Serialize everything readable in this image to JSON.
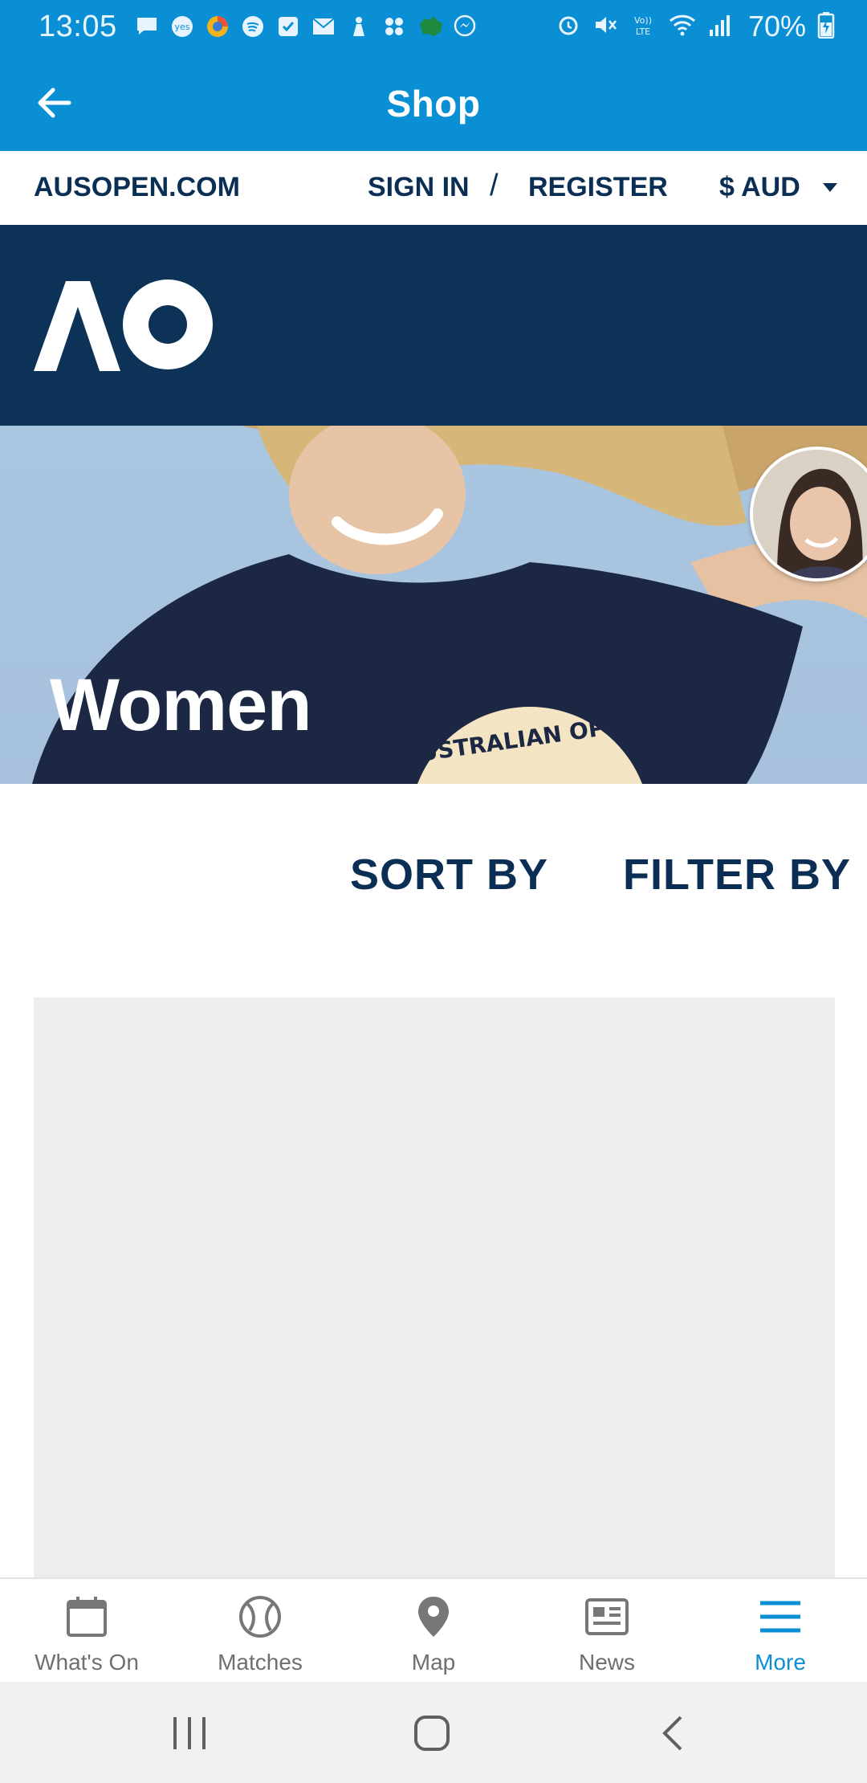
{
  "status_bar": {
    "time": "13:05",
    "battery": "70%",
    "notification_icons": [
      "message-icon",
      "yes-icon",
      "browser-icon",
      "spotify-icon",
      "tasks-icon",
      "mail-icon",
      "bixby-icon",
      "app-icon",
      "australia-icon",
      "messenger-icon"
    ],
    "system_icons": [
      "alarm-icon",
      "mute-icon",
      "volte-icon",
      "wifi-icon",
      "signal-icon",
      "battery-icon"
    ]
  },
  "app_bar": {
    "title": "Shop",
    "back_icon": "arrow-left-icon"
  },
  "utility_bar": {
    "site_link": "AUSOPEN.COM",
    "sign_in": "SIGN IN",
    "separator": "/",
    "register": "REGISTER",
    "currency": "$ AUD"
  },
  "brand": {
    "logo_text": "AO"
  },
  "hero": {
    "title": "Women",
    "shirt_text": "AUSTRALIAN OPEN"
  },
  "controls": {
    "sort": "SORT BY",
    "filter": "FILTER BY"
  },
  "bottom_nav": {
    "items": [
      {
        "label": "What's On",
        "icon": "calendar-icon"
      },
      {
        "label": "Matches",
        "icon": "tennis-ball-icon"
      },
      {
        "label": "Map",
        "icon": "map-pin-icon"
      },
      {
        "label": "News",
        "icon": "news-icon"
      },
      {
        "label": "More",
        "icon": "menu-icon"
      }
    ],
    "active": "More"
  },
  "colors": {
    "primary": "#0a8fd4",
    "navy": "#0c3257",
    "text_navy": "#0b2f54",
    "placeholder": "#ededed"
  }
}
